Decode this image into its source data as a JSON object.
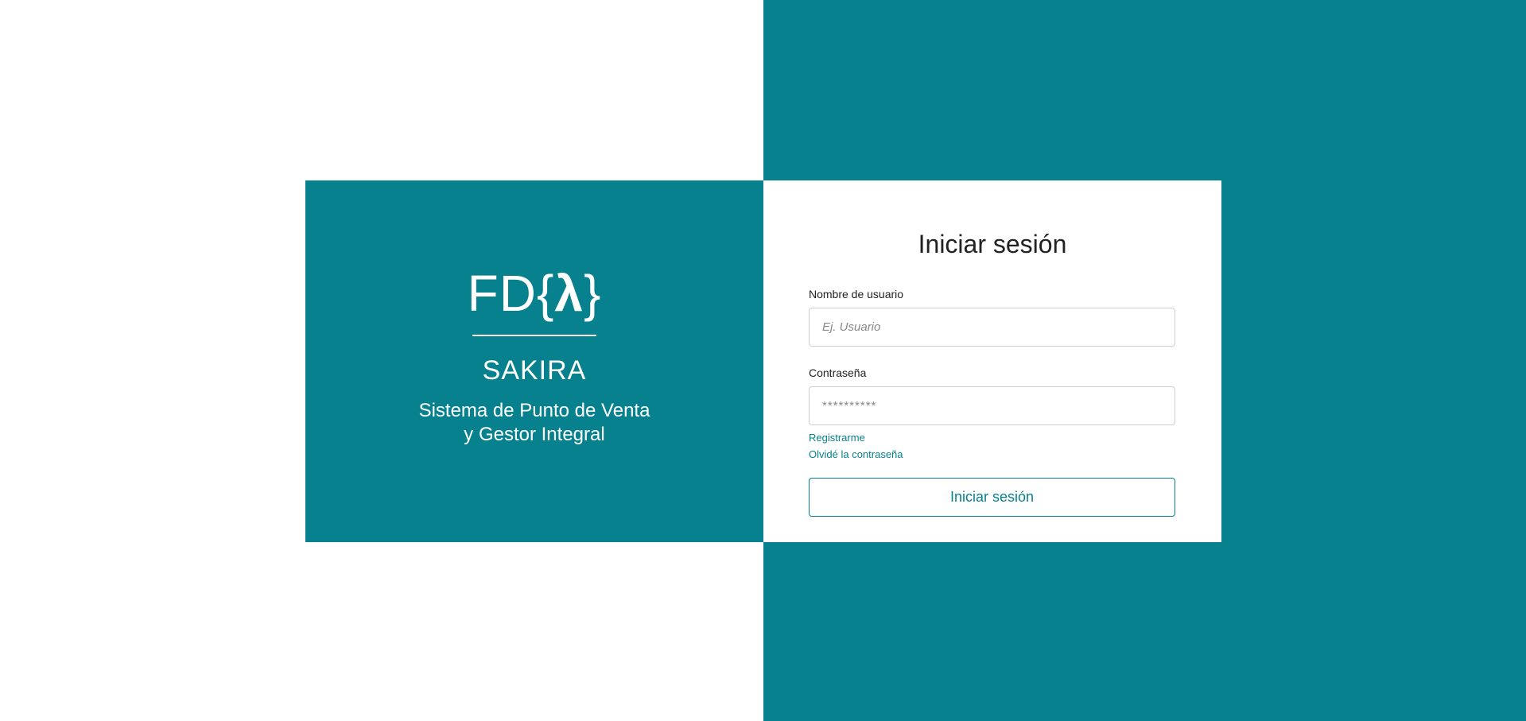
{
  "colors": {
    "accent": "#07818d",
    "background": "#ffffff",
    "text": "#222222"
  },
  "brand": {
    "logo_prefix": "FD{",
    "logo_symbol": "λ",
    "logo_suffix": "}",
    "app_name": "SAKIRA",
    "description_line1": "Sistema de Punto de Venta",
    "description_line2": "y Gestor Integral"
  },
  "login": {
    "title": "Iniciar sesión",
    "username_label": "Nombre de usuario",
    "username_placeholder": "Ej. Usuario",
    "username_value": "",
    "password_label": "Contraseña",
    "password_placeholder": "**********",
    "password_value": "",
    "register_link": "Registrarme",
    "forgot_link": "Olvidé la contraseña",
    "submit_label": "Iniciar sesión"
  }
}
